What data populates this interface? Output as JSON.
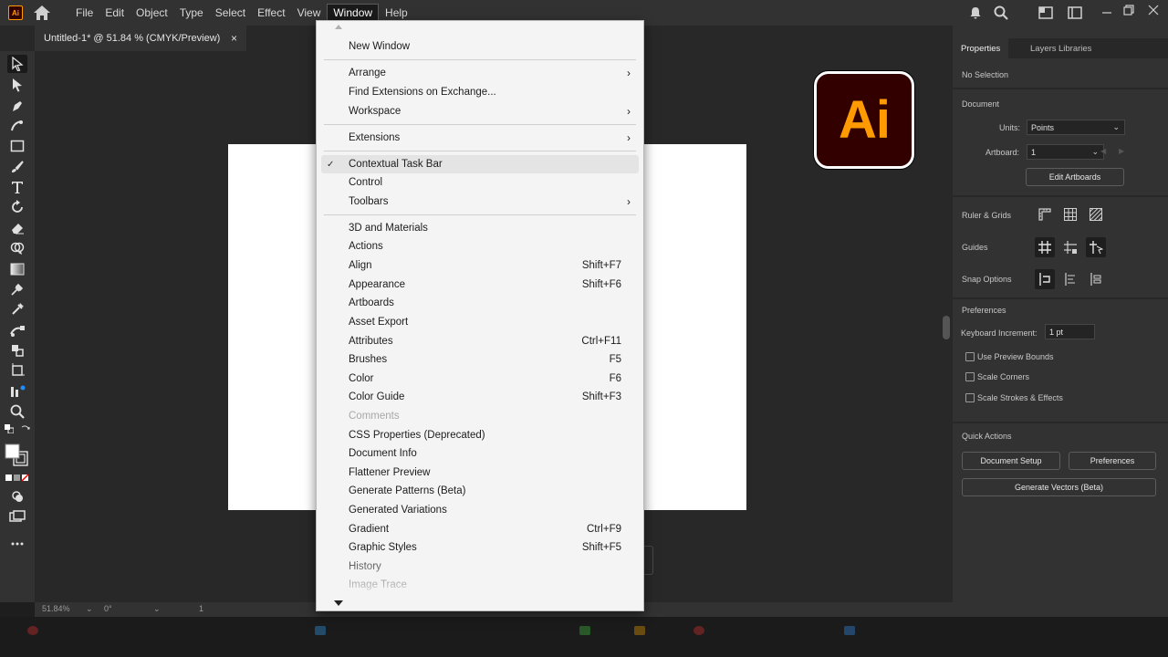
{
  "menubar": {
    "app_badge": "Ai",
    "items": [
      "File",
      "Edit",
      "Object",
      "Type",
      "Select",
      "Effect",
      "View",
      "Window",
      "Help"
    ],
    "active_item": "Window"
  },
  "document_tab": {
    "title": "Untitled-1* @ 51.84 % (CMYK/Preview)",
    "close": "×"
  },
  "window_menu": {
    "items": [
      {
        "label": "New Window"
      },
      {
        "label": "Arrange",
        "submenu": true
      },
      {
        "label": "Find Extensions on Exchange..."
      },
      {
        "label": "Workspace",
        "submenu": true
      },
      {
        "label": "Extensions",
        "submenu": true
      },
      {
        "label": "Contextual Task Bar",
        "checked": true
      },
      {
        "label": "Control"
      },
      {
        "label": "Toolbars",
        "submenu": true
      },
      {
        "label": "3D and Materials"
      },
      {
        "label": "Actions"
      },
      {
        "label": "Align",
        "shortcut": "Shift+F7"
      },
      {
        "label": "Appearance",
        "shortcut": "Shift+F6"
      },
      {
        "label": "Artboards"
      },
      {
        "label": "Asset Export"
      },
      {
        "label": "Attributes",
        "shortcut": "Ctrl+F11"
      },
      {
        "label": "Brushes",
        "shortcut": "F5"
      },
      {
        "label": "Color",
        "shortcut": "F6"
      },
      {
        "label": "Color Guide",
        "shortcut": "Shift+F3"
      },
      {
        "label": "Comments",
        "disabled": true
      },
      {
        "label": "CSS Properties (Deprecated)"
      },
      {
        "label": "Document Info"
      },
      {
        "label": "Flattener Preview"
      },
      {
        "label": "Generate Patterns (Beta)"
      },
      {
        "label": "Generated Variations"
      },
      {
        "label": "Gradient",
        "shortcut": "Ctrl+F9"
      },
      {
        "label": "Graphic Styles",
        "shortcut": "Shift+F5"
      },
      {
        "label": "History"
      },
      {
        "label": "Image Trace"
      }
    ]
  },
  "ai_logo": {
    "text": "Ai"
  },
  "properties_panel": {
    "tabs": [
      "Properties",
      "Layers",
      "Libraries"
    ],
    "active_tab": "Properties",
    "selection": "No Selection",
    "document_heading": "Document",
    "units_label": "Units:",
    "units_value": "Points",
    "artboard_label": "Artboard:",
    "artboard_value": "1",
    "edit_artboards": "Edit Artboards",
    "ruler_grids": "Ruler & Grids",
    "guides": "Guides",
    "snap_options": "Snap Options",
    "preferences_heading": "Preferences",
    "keyboard_increment_label": "Keyboard Increment:",
    "keyboard_increment_value": "1 pt",
    "use_preview_bounds": "Use Preview Bounds",
    "scale_corners": "Scale Corners",
    "scale_strokes": "Scale Strokes & Effects",
    "quick_actions": "Quick Actions",
    "document_setup": "Document Setup",
    "preferences_button": "Preferences",
    "generate_vectors": "Generate Vectors (Beta)"
  },
  "statusbar": {
    "zoom": "51.84%",
    "rotate": "0°",
    "artboard": "1"
  },
  "colors": {
    "brand": "#ff9a00",
    "brand_bg": "#330000",
    "chrome": "#323232",
    "canvas": "#282828"
  }
}
